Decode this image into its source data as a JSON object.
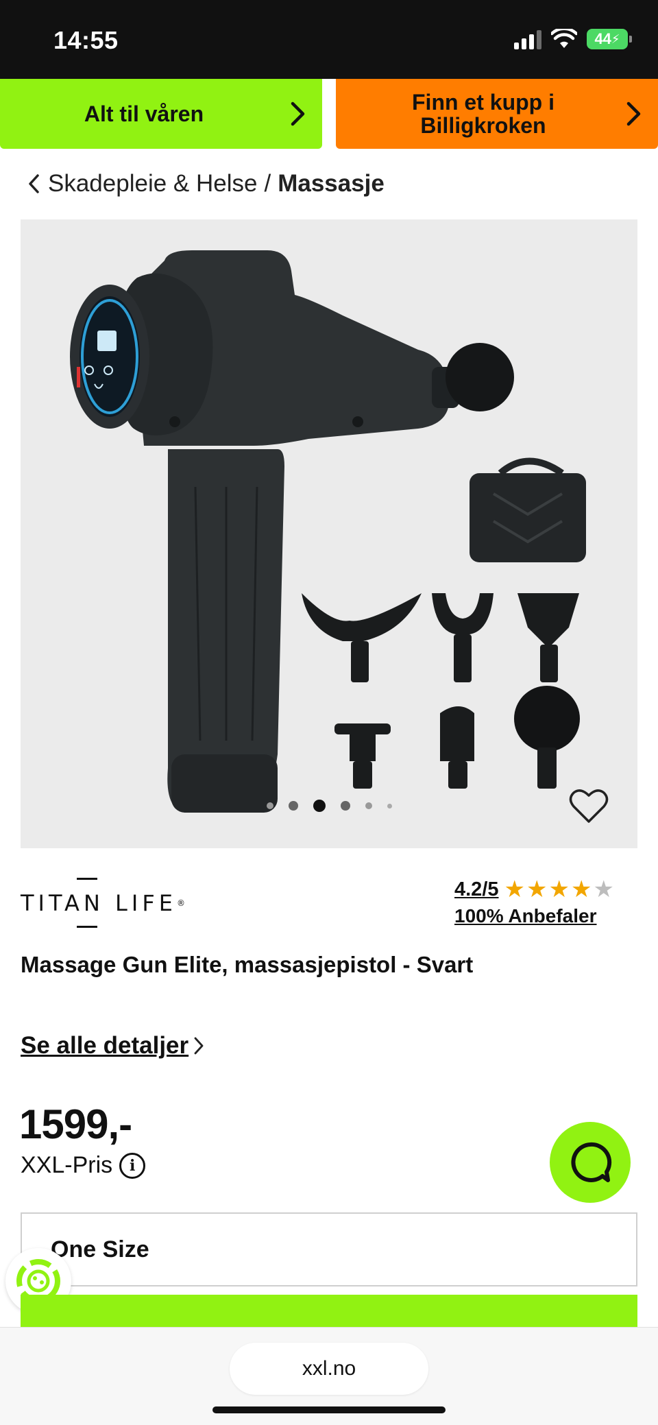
{
  "status_bar": {
    "time": "14:55",
    "battery": "44",
    "icons": [
      "signal-icon",
      "wifi-icon",
      "battery-icon"
    ]
  },
  "promos": [
    {
      "label": "Alt til våren",
      "color": "#91f212"
    },
    {
      "label": "Finn et kupp i Billigkroken",
      "color": "#ff7d00"
    }
  ],
  "breadcrumb": {
    "parent": "Skadepleie & Helse",
    "separator": "/",
    "current": "Massasje"
  },
  "gallery": {
    "dot_count": 6,
    "active_index": 2
  },
  "product": {
    "brand": "TITAN LIFE",
    "brand_mark": "®",
    "rating": "4.2/5",
    "rating_value": 4.2,
    "rating_max": 5,
    "recommend": "100% Anbefaler",
    "title": "Massage Gun Elite, massasjepistol - Svart",
    "details_link": "Se alle detaljer",
    "price": "1599,-",
    "price_type": "XXL-Pris",
    "size": "One Size"
  },
  "browser": {
    "url": "xxl.no"
  },
  "colors": {
    "accent_green": "#91f212",
    "accent_orange": "#ff7d00",
    "star": "#f2a600"
  }
}
